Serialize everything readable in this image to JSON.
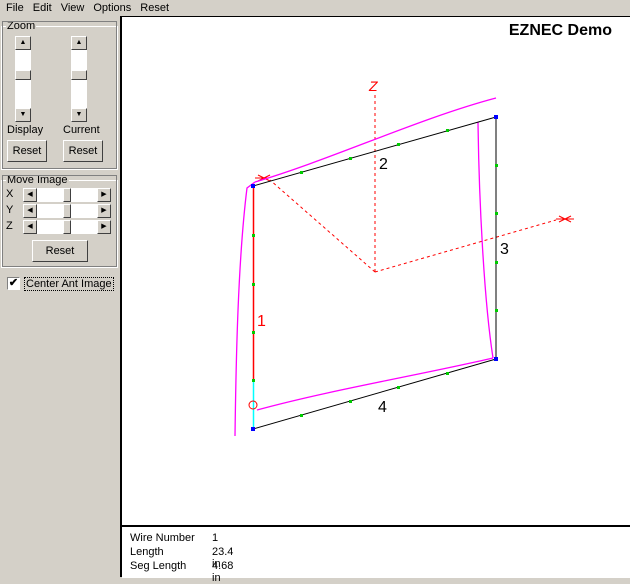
{
  "menu": [
    "File",
    "Edit",
    "View",
    "Options",
    "Reset"
  ],
  "zoom": {
    "title": "Zoom",
    "display_label": "Display",
    "current_label": "Current",
    "reset": "Reset"
  },
  "move": {
    "title": "Move Image",
    "axes": [
      "X",
      "Y",
      "Z"
    ],
    "reset": "Reset"
  },
  "center": {
    "label": "Center Ant Image",
    "checked": true
  },
  "canvas": {
    "title": "EZNEC Demo",
    "axis_z": "Z",
    "wire_labels": [
      "1",
      "2",
      "3",
      "4"
    ]
  },
  "info": {
    "rows": [
      {
        "label": "Wire Number",
        "value": "1"
      },
      {
        "label": "Length",
        "value": "23.4 in"
      },
      {
        "label": "Seg Length",
        "value": "4.68 in"
      }
    ]
  },
  "colors": {
    "selected_wire": "#ff0000",
    "current": "#ff00ff",
    "source": "#00ffff",
    "axis": "#ff0000",
    "segment": "#00cc00",
    "wire_end": "#0000ff"
  }
}
